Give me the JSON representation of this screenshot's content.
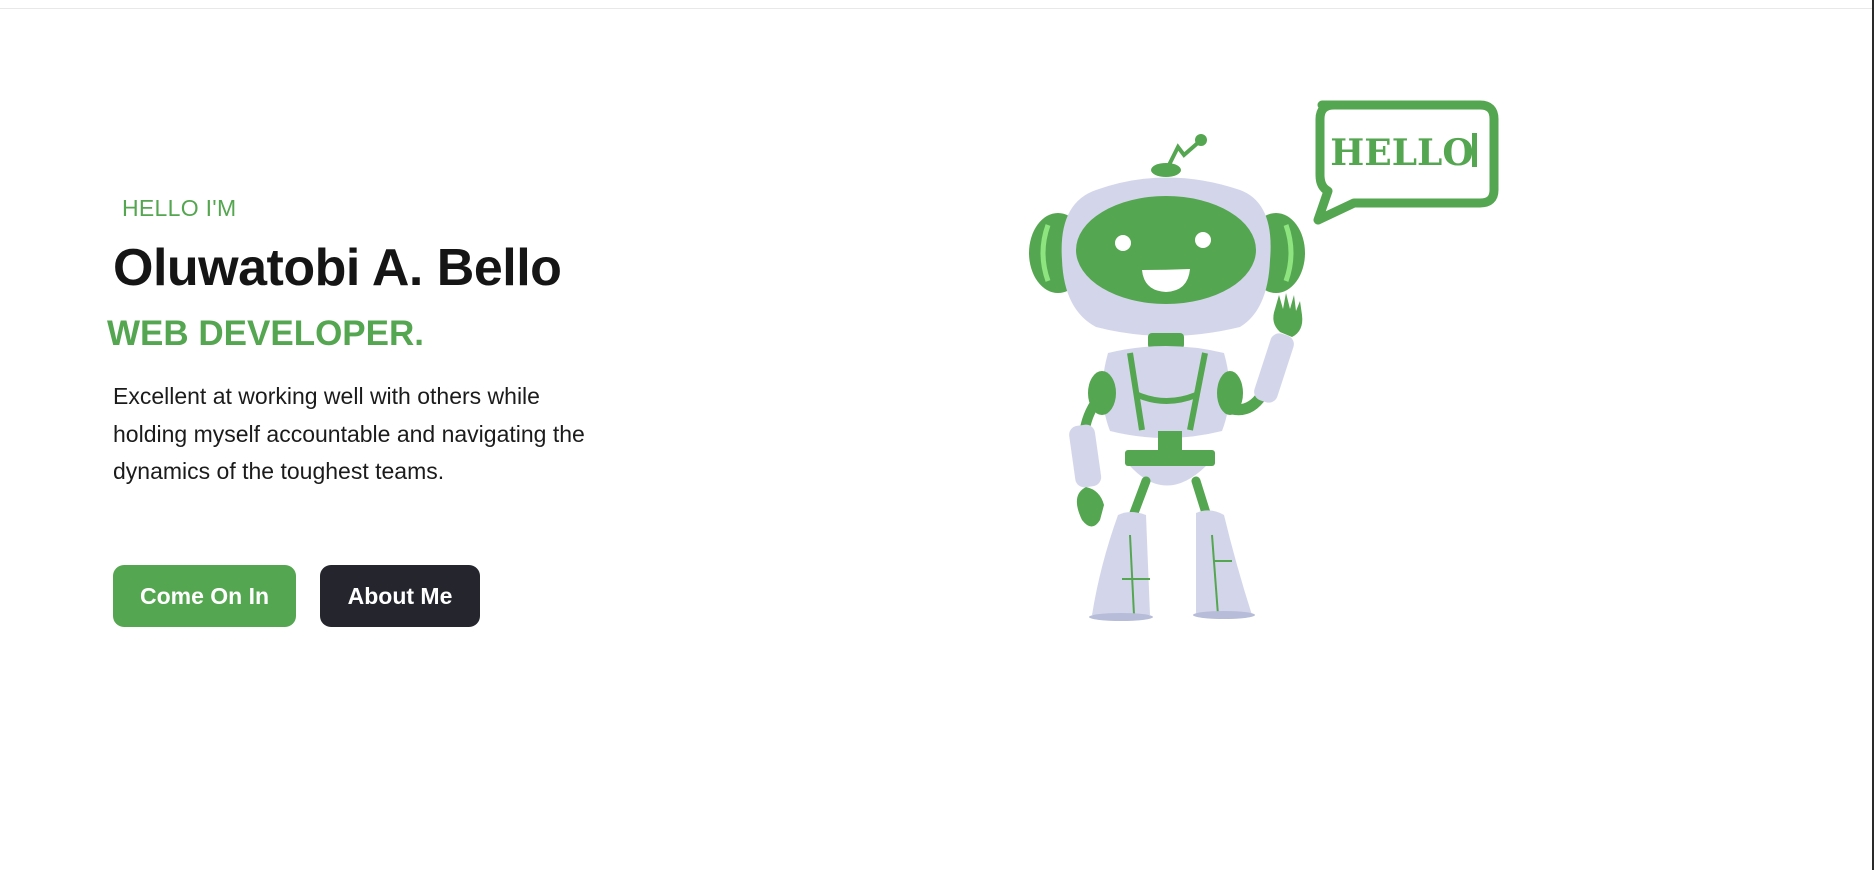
{
  "hero": {
    "eyebrow": "HELLO I'M",
    "name": "Oluwatobi A. Bello",
    "role": "WEB DEVELOPER.",
    "tagline": "Excellent at working well with others while holding myself accountable and navigating the dynamics of the toughest teams.",
    "primary_button": "Come On In",
    "secondary_button": "About Me"
  },
  "illustration": {
    "icon": "waving-robot-illustration",
    "speech_bubble_text": "HELLO"
  },
  "colors": {
    "accent": "#55a650",
    "dark_button": "#25262d",
    "heading": "#151515",
    "robot_body": "#d3d6ea"
  }
}
